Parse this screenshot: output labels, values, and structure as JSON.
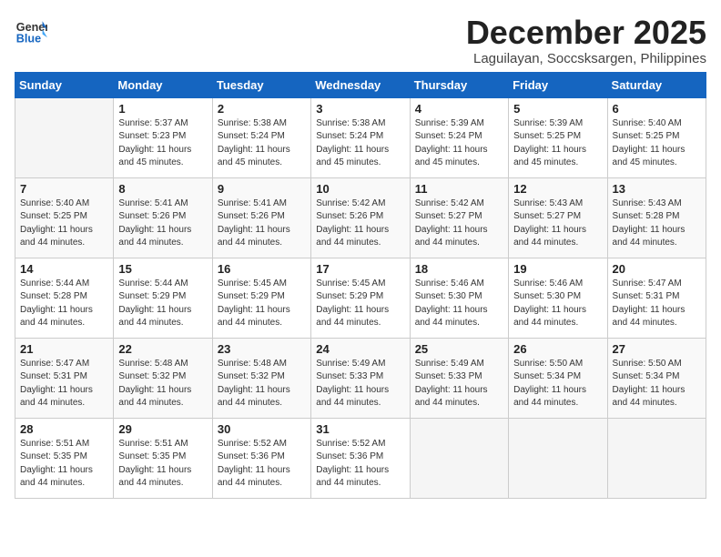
{
  "logo": {
    "general": "General",
    "blue": "Blue"
  },
  "header": {
    "month": "December 2025",
    "location": "Laguilayan, Soccsksargen, Philippines"
  },
  "weekdays": [
    "Sunday",
    "Monday",
    "Tuesday",
    "Wednesday",
    "Thursday",
    "Friday",
    "Saturday"
  ],
  "weeks": [
    [
      {
        "day": "",
        "sunrise": "",
        "sunset": "",
        "daylight": ""
      },
      {
        "day": "1",
        "sunrise": "Sunrise: 5:37 AM",
        "sunset": "Sunset: 5:23 PM",
        "daylight": "Daylight: 11 hours and 45 minutes."
      },
      {
        "day": "2",
        "sunrise": "Sunrise: 5:38 AM",
        "sunset": "Sunset: 5:24 PM",
        "daylight": "Daylight: 11 hours and 45 minutes."
      },
      {
        "day": "3",
        "sunrise": "Sunrise: 5:38 AM",
        "sunset": "Sunset: 5:24 PM",
        "daylight": "Daylight: 11 hours and 45 minutes."
      },
      {
        "day": "4",
        "sunrise": "Sunrise: 5:39 AM",
        "sunset": "Sunset: 5:24 PM",
        "daylight": "Daylight: 11 hours and 45 minutes."
      },
      {
        "day": "5",
        "sunrise": "Sunrise: 5:39 AM",
        "sunset": "Sunset: 5:25 PM",
        "daylight": "Daylight: 11 hours and 45 minutes."
      },
      {
        "day": "6",
        "sunrise": "Sunrise: 5:40 AM",
        "sunset": "Sunset: 5:25 PM",
        "daylight": "Daylight: 11 hours and 45 minutes."
      }
    ],
    [
      {
        "day": "7",
        "sunrise": "Sunrise: 5:40 AM",
        "sunset": "Sunset: 5:25 PM",
        "daylight": "Daylight: 11 hours and 44 minutes."
      },
      {
        "day": "8",
        "sunrise": "Sunrise: 5:41 AM",
        "sunset": "Sunset: 5:26 PM",
        "daylight": "Daylight: 11 hours and 44 minutes."
      },
      {
        "day": "9",
        "sunrise": "Sunrise: 5:41 AM",
        "sunset": "Sunset: 5:26 PM",
        "daylight": "Daylight: 11 hours and 44 minutes."
      },
      {
        "day": "10",
        "sunrise": "Sunrise: 5:42 AM",
        "sunset": "Sunset: 5:26 PM",
        "daylight": "Daylight: 11 hours and 44 minutes."
      },
      {
        "day": "11",
        "sunrise": "Sunrise: 5:42 AM",
        "sunset": "Sunset: 5:27 PM",
        "daylight": "Daylight: 11 hours and 44 minutes."
      },
      {
        "day": "12",
        "sunrise": "Sunrise: 5:43 AM",
        "sunset": "Sunset: 5:27 PM",
        "daylight": "Daylight: 11 hours and 44 minutes."
      },
      {
        "day": "13",
        "sunrise": "Sunrise: 5:43 AM",
        "sunset": "Sunset: 5:28 PM",
        "daylight": "Daylight: 11 hours and 44 minutes."
      }
    ],
    [
      {
        "day": "14",
        "sunrise": "Sunrise: 5:44 AM",
        "sunset": "Sunset: 5:28 PM",
        "daylight": "Daylight: 11 hours and 44 minutes."
      },
      {
        "day": "15",
        "sunrise": "Sunrise: 5:44 AM",
        "sunset": "Sunset: 5:29 PM",
        "daylight": "Daylight: 11 hours and 44 minutes."
      },
      {
        "day": "16",
        "sunrise": "Sunrise: 5:45 AM",
        "sunset": "Sunset: 5:29 PM",
        "daylight": "Daylight: 11 hours and 44 minutes."
      },
      {
        "day": "17",
        "sunrise": "Sunrise: 5:45 AM",
        "sunset": "Sunset: 5:29 PM",
        "daylight": "Daylight: 11 hours and 44 minutes."
      },
      {
        "day": "18",
        "sunrise": "Sunrise: 5:46 AM",
        "sunset": "Sunset: 5:30 PM",
        "daylight": "Daylight: 11 hours and 44 minutes."
      },
      {
        "day": "19",
        "sunrise": "Sunrise: 5:46 AM",
        "sunset": "Sunset: 5:30 PM",
        "daylight": "Daylight: 11 hours and 44 minutes."
      },
      {
        "day": "20",
        "sunrise": "Sunrise: 5:47 AM",
        "sunset": "Sunset: 5:31 PM",
        "daylight": "Daylight: 11 hours and 44 minutes."
      }
    ],
    [
      {
        "day": "21",
        "sunrise": "Sunrise: 5:47 AM",
        "sunset": "Sunset: 5:31 PM",
        "daylight": "Daylight: 11 hours and 44 minutes."
      },
      {
        "day": "22",
        "sunrise": "Sunrise: 5:48 AM",
        "sunset": "Sunset: 5:32 PM",
        "daylight": "Daylight: 11 hours and 44 minutes."
      },
      {
        "day": "23",
        "sunrise": "Sunrise: 5:48 AM",
        "sunset": "Sunset: 5:32 PM",
        "daylight": "Daylight: 11 hours and 44 minutes."
      },
      {
        "day": "24",
        "sunrise": "Sunrise: 5:49 AM",
        "sunset": "Sunset: 5:33 PM",
        "daylight": "Daylight: 11 hours and 44 minutes."
      },
      {
        "day": "25",
        "sunrise": "Sunrise: 5:49 AM",
        "sunset": "Sunset: 5:33 PM",
        "daylight": "Daylight: 11 hours and 44 minutes."
      },
      {
        "day": "26",
        "sunrise": "Sunrise: 5:50 AM",
        "sunset": "Sunset: 5:34 PM",
        "daylight": "Daylight: 11 hours and 44 minutes."
      },
      {
        "day": "27",
        "sunrise": "Sunrise: 5:50 AM",
        "sunset": "Sunset: 5:34 PM",
        "daylight": "Daylight: 11 hours and 44 minutes."
      }
    ],
    [
      {
        "day": "28",
        "sunrise": "Sunrise: 5:51 AM",
        "sunset": "Sunset: 5:35 PM",
        "daylight": "Daylight: 11 hours and 44 minutes."
      },
      {
        "day": "29",
        "sunrise": "Sunrise: 5:51 AM",
        "sunset": "Sunset: 5:35 PM",
        "daylight": "Daylight: 11 hours and 44 minutes."
      },
      {
        "day": "30",
        "sunrise": "Sunrise: 5:52 AM",
        "sunset": "Sunset: 5:36 PM",
        "daylight": "Daylight: 11 hours and 44 minutes."
      },
      {
        "day": "31",
        "sunrise": "Sunrise: 5:52 AM",
        "sunset": "Sunset: 5:36 PM",
        "daylight": "Daylight: 11 hours and 44 minutes."
      },
      {
        "day": "",
        "sunrise": "",
        "sunset": "",
        "daylight": ""
      },
      {
        "day": "",
        "sunrise": "",
        "sunset": "",
        "daylight": ""
      },
      {
        "day": "",
        "sunrise": "",
        "sunset": "",
        "daylight": ""
      }
    ]
  ]
}
